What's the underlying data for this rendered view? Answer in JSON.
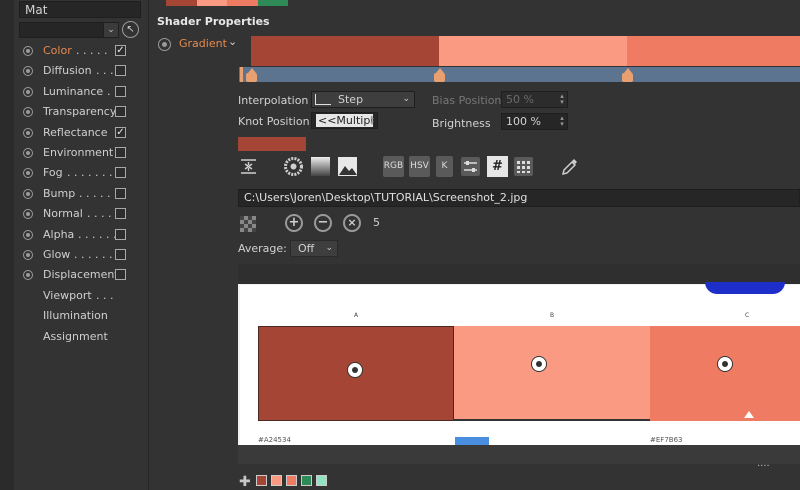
{
  "material_name": "Mat",
  "channels": [
    {
      "label": "Color",
      "dots": ". . . . .",
      "checked": true,
      "active": true,
      "has_checkbox": true
    },
    {
      "label": "Diffusion",
      "dots": ". . .",
      "checked": false,
      "active": false,
      "has_checkbox": true
    },
    {
      "label": "Luminance",
      "dots": ". .",
      "checked": false,
      "active": false,
      "has_checkbox": true
    },
    {
      "label": "Transparency",
      "dots": "",
      "checked": false,
      "active": false,
      "has_checkbox": true
    },
    {
      "label": "Reflectance",
      "dots": "",
      "checked": true,
      "active": false,
      "has_checkbox": true
    },
    {
      "label": "Environment",
      "dots": "",
      "checked": false,
      "active": false,
      "has_checkbox": true
    },
    {
      "label": "Fog",
      "dots": ". . . . . . .",
      "checked": false,
      "active": false,
      "has_checkbox": true
    },
    {
      "label": "Bump",
      "dots": ". . . . . .",
      "checked": false,
      "active": false,
      "has_checkbox": true
    },
    {
      "label": "Normal",
      "dots": ". . . . .",
      "checked": false,
      "active": false,
      "has_checkbox": true
    },
    {
      "label": "Alpha",
      "dots": ". . . . . .",
      "checked": false,
      "active": false,
      "has_checkbox": true
    },
    {
      "label": "Glow",
      "dots": ". . . . . .",
      "checked": false,
      "active": false,
      "has_checkbox": true
    },
    {
      "label": "Displacement",
      "dots": "",
      "checked": false,
      "active": false,
      "has_checkbox": true
    },
    {
      "label": "Viewport",
      "dots": ". . .",
      "checked": false,
      "active": false,
      "has_checkbox": false
    },
    {
      "label": "Illumination",
      "dots": "",
      "checked": false,
      "active": false,
      "has_checkbox": false
    },
    {
      "label": "Assignment",
      "dots": "",
      "checked": false,
      "active": false,
      "has_checkbox": false
    }
  ],
  "shader": {
    "title": "Shader Properties",
    "type_label": "Gradient",
    "gradient_colors": [
      "#a54535",
      "#fb9a82",
      "#ef7b63"
    ],
    "interpolation_label": "Interpolation",
    "interpolation_value": "Step",
    "knot_position_label": "Knot Position",
    "knot_position_value": "<<Multipl",
    "bias_position_label": "Bias Position",
    "bias_position_value": "50 %",
    "brightness_label": "Brightness",
    "brightness_value": "100 %",
    "knot_color": "#a54535"
  },
  "toolbar": {
    "rgb": "RGB",
    "hsv": "HSV",
    "k": "K",
    "hash": "#"
  },
  "image_path": "C:\\Users\\Joren\\Desktop\\TUTORIAL\\Screenshot_2.jpg",
  "sample_count": "5",
  "average_label": "Average:",
  "average_value": "Off",
  "preview": {
    "headers": [
      "A",
      "B",
      "C"
    ],
    "footer_left": "#A24534",
    "footer_right": "#EF7B63",
    "block_colors": [
      "#a54535",
      "#fb9a82",
      "#ef7b63"
    ]
  },
  "bottom_swatches": [
    "#a54535",
    "#fb9a82",
    "#ef7b63",
    "#2e8b57",
    "#8fe3c0"
  ]
}
